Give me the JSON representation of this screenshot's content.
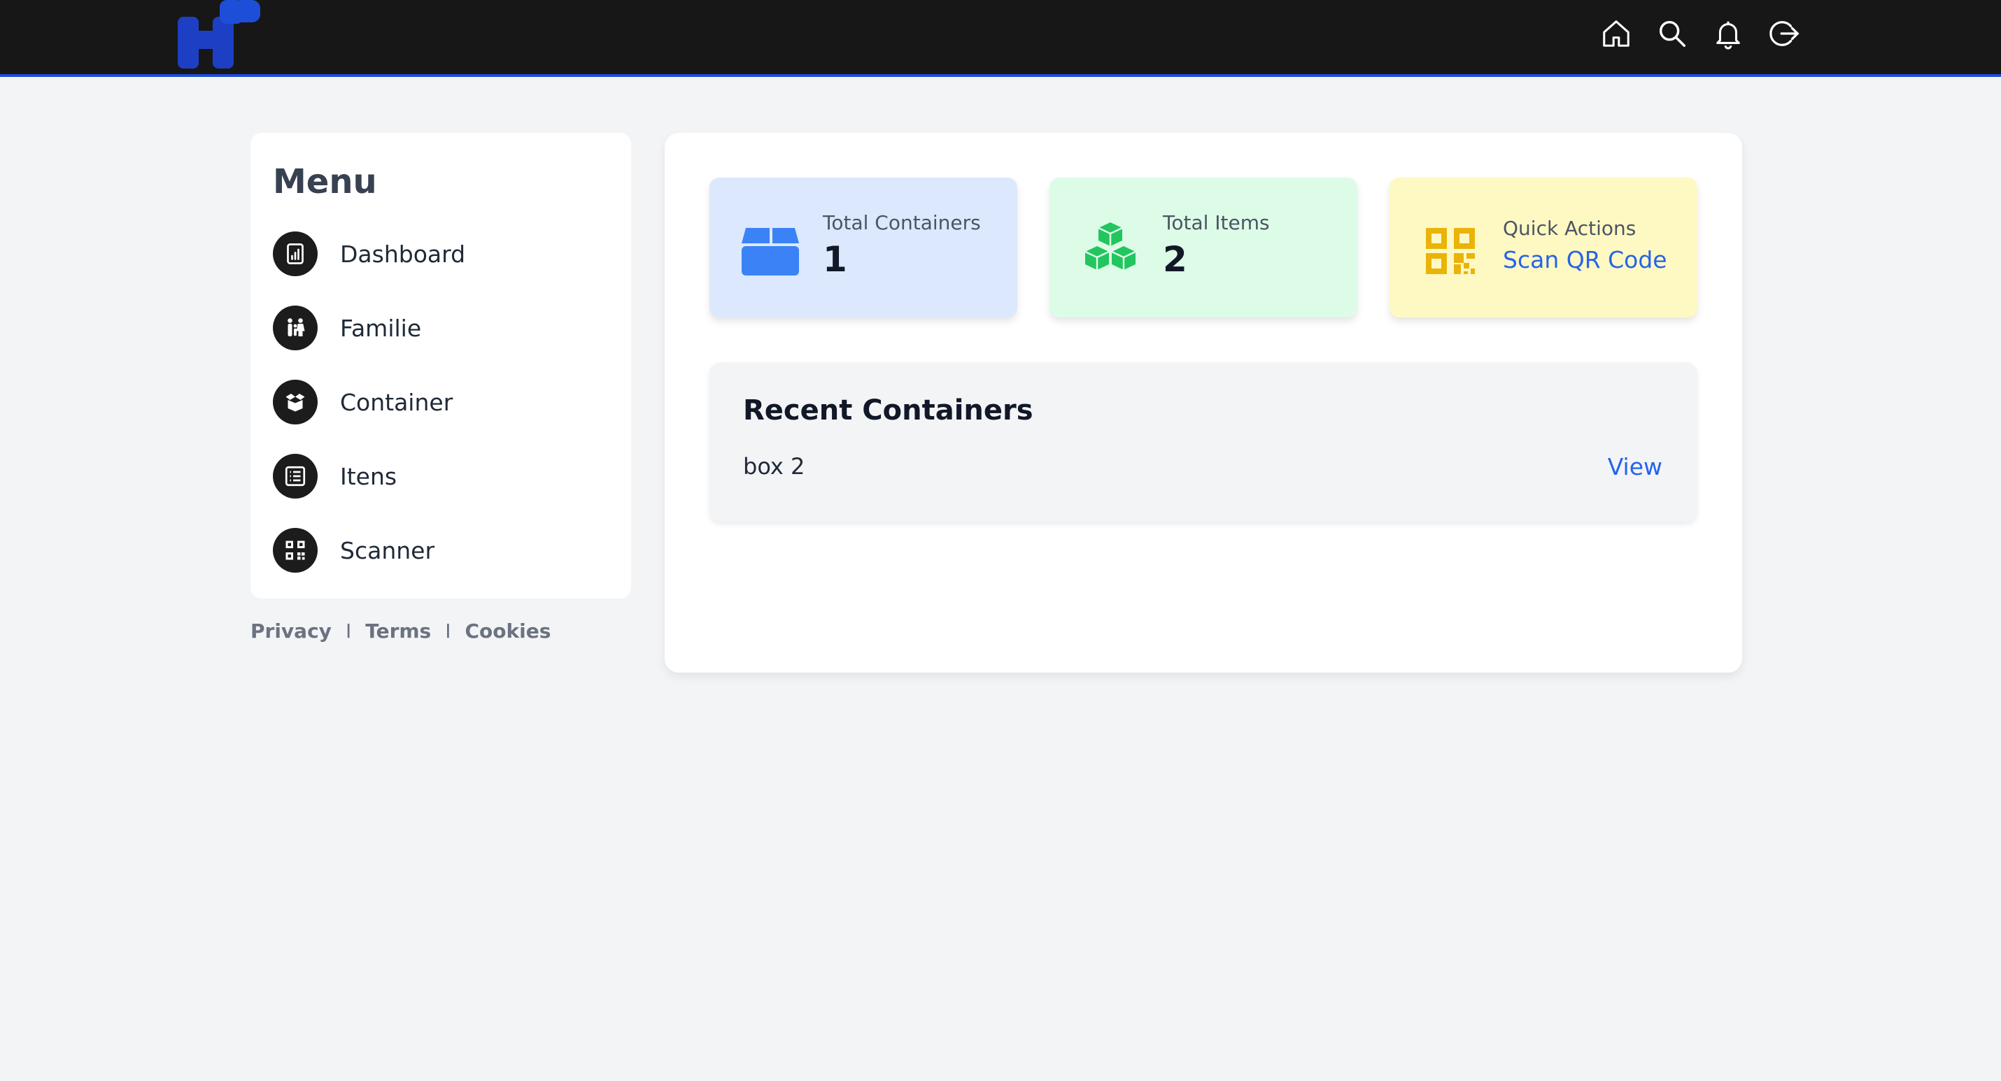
{
  "header": {
    "brand_color": "#1d4ed8",
    "icons": [
      "home-icon",
      "search-icon",
      "bell-icon",
      "logout-icon"
    ]
  },
  "sidebar": {
    "title": "Menu",
    "items": [
      {
        "label": "Dashboard",
        "icon": "dashboard-icon"
      },
      {
        "label": "Familie",
        "icon": "family-icon"
      },
      {
        "label": "Container",
        "icon": "container-box-icon"
      },
      {
        "label": "Itens",
        "icon": "list-icon"
      },
      {
        "label": "Scanner",
        "icon": "qr-code-icon"
      }
    ]
  },
  "footer": {
    "links": [
      "Privacy",
      "Terms",
      "Cookies"
    ],
    "separator": "I"
  },
  "stats": {
    "containers": {
      "label": "Total Containers",
      "value": "1",
      "icon": "box-icon",
      "color": "#3b82f6"
    },
    "items": {
      "label": "Total Items",
      "value": "2",
      "icon": "cubes-icon",
      "color": "#22c55e"
    },
    "quick": {
      "label": "Quick Actions",
      "link": "Scan QR Code",
      "icon": "qr-code-icon",
      "color": "#eab308"
    }
  },
  "recent": {
    "title": "Recent Containers",
    "rows": [
      {
        "name": "box 2",
        "action": "View"
      }
    ]
  }
}
